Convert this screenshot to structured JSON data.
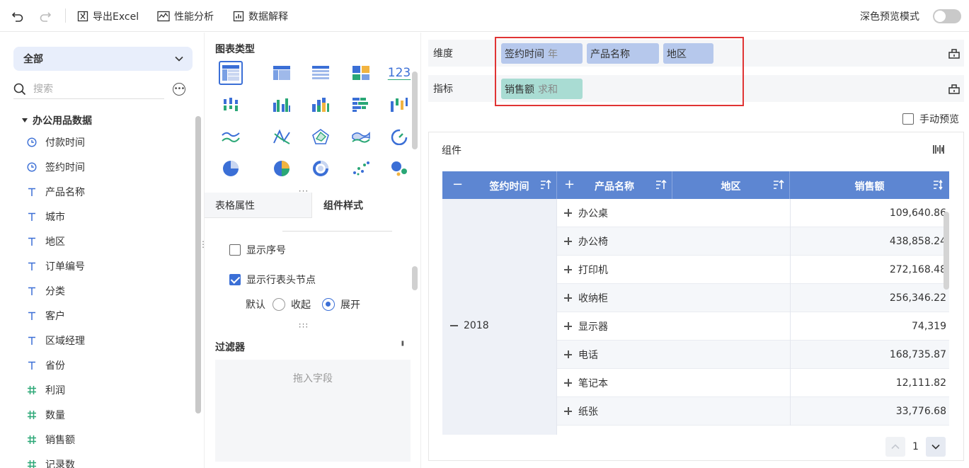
{
  "toolbar": {
    "export_label": "导出Excel",
    "perf_label": "性能分析",
    "explain_label": "数据解释",
    "dark_preview_label": "深色预览模式"
  },
  "fields": {
    "dataset_select": "全部",
    "search_placeholder": "搜索",
    "group_name": "办公用品数据",
    "items": [
      {
        "label": "付款时间",
        "icon": "clock-icon"
      },
      {
        "label": "签约时间",
        "icon": "clock-icon"
      },
      {
        "label": "产品名称",
        "icon": "text-type-icon"
      },
      {
        "label": "城市",
        "icon": "text-type-icon"
      },
      {
        "label": "地区",
        "icon": "text-type-icon"
      },
      {
        "label": "订单编号",
        "icon": "text-type-icon"
      },
      {
        "label": "分类",
        "icon": "text-type-icon"
      },
      {
        "label": "客户",
        "icon": "text-type-icon"
      },
      {
        "label": "区域经理",
        "icon": "text-type-icon"
      },
      {
        "label": "省份",
        "icon": "text-type-icon"
      },
      {
        "label": "利润",
        "icon": "hash-icon"
      },
      {
        "label": "数量",
        "icon": "hash-icon"
      },
      {
        "label": "销售额",
        "icon": "hash-icon"
      },
      {
        "label": "记录数",
        "icon": "hash-icon"
      }
    ]
  },
  "chart_types": {
    "title": "图表类型",
    "number_icon_text": "123"
  },
  "style_tabs": {
    "table_props": "表格属性",
    "component_style": "组件样式"
  },
  "style_options": {
    "show_index": "显示序号",
    "show_row_header_node": "显示行表头节点",
    "default_label": "默认",
    "collapse_label": "收起",
    "expand_label": "展开"
  },
  "filter": {
    "title": "过滤器",
    "drop_hint": "拖入字段"
  },
  "config": {
    "dimension_label": "维度",
    "metric_label": "指标",
    "dimensions": [
      {
        "name": "签约时间",
        "sub": "年"
      },
      {
        "name": "产品名称",
        "sub": ""
      },
      {
        "name": "地区",
        "sub": ""
      }
    ],
    "metrics": [
      {
        "name": "销售额",
        "sub": "求和"
      }
    ],
    "manual_preview": "手动预览",
    "highlight_color": "#e03434"
  },
  "component": {
    "title": "组件"
  },
  "table": {
    "headers": [
      "签约时间",
      "产品名称",
      "地区",
      "销售额"
    ],
    "year": "2018",
    "rows": [
      {
        "product": "办公桌",
        "value": "109,640.86"
      },
      {
        "product": "办公椅",
        "value": "438,858.24"
      },
      {
        "product": "打印机",
        "value": "272,168.48"
      },
      {
        "product": "收纳柜",
        "value": "256,346.22"
      },
      {
        "product": "显示器",
        "value": "74,319"
      },
      {
        "product": "电话",
        "value": "168,735.87"
      },
      {
        "product": "笔记本",
        "value": "12,111.82"
      },
      {
        "product": "纸张",
        "value": "33,776.68"
      }
    ],
    "header_color": "#5d86d2"
  },
  "pager": {
    "page": "1"
  }
}
